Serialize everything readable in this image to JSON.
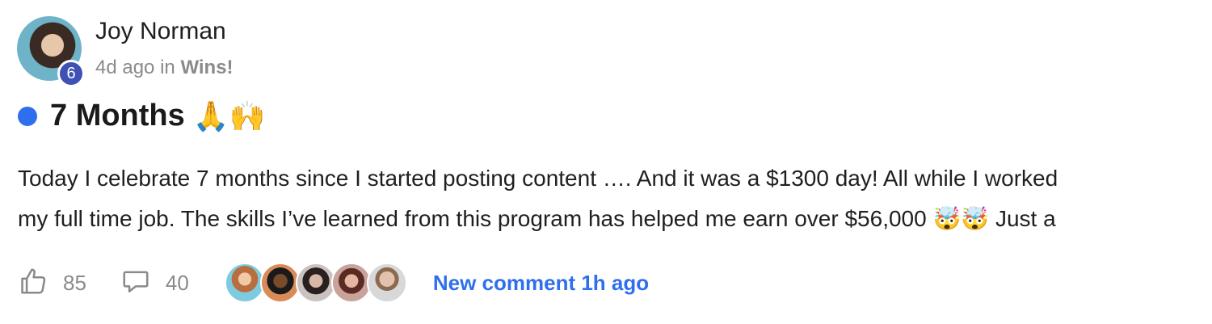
{
  "post": {
    "author": "Joy Norman",
    "level": "6",
    "time": "4d ago",
    "in_label": "in",
    "category": "Wins!",
    "title": "7 Months",
    "title_emoji": "🙏🙌",
    "body_line1": "Today I celebrate 7 months since I started posting content …. And it was a $1300 day! All while I worked",
    "body_line2": "my full time job. The skills I’ve learned from this program has helped me earn over $56,000 🤯🤯 Just a"
  },
  "actions": {
    "likes": "85",
    "comments": "40",
    "commenter_avatars": [
      "commenter-1",
      "commenter-2",
      "commenter-3",
      "commenter-4",
      "commenter-5"
    ],
    "new_comment_text": "New comment 1h ago"
  },
  "colors": {
    "accent": "#2f6fed",
    "badge": "#3f51b5",
    "muted": "#8a8a8a"
  },
  "icons": {
    "like": "thumbs-up-icon",
    "comment": "speech-bubble-icon"
  }
}
